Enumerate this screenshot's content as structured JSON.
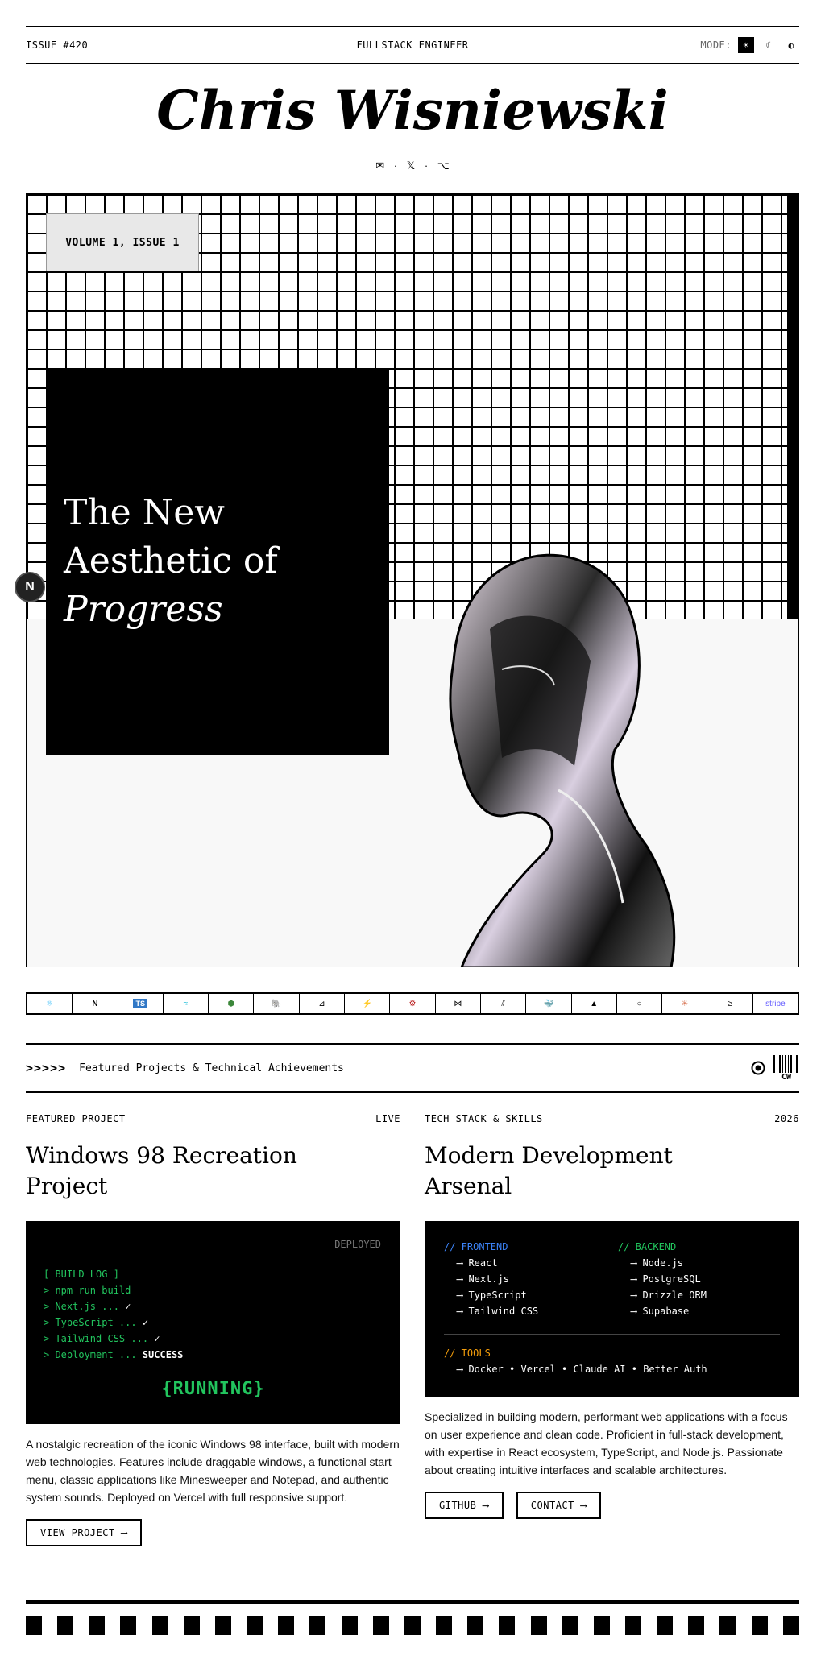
{
  "topbar": {
    "issue": "ISSUE #420",
    "role": "FULLSTACK ENGINEER",
    "mode_label": "MODE:",
    "modes": [
      "☀",
      "☾",
      "◐"
    ]
  },
  "masthead": {
    "name": "Chris Wisniewski"
  },
  "social": {
    "items": [
      "✉",
      "𝕏",
      "⌥"
    ],
    "sep": "·"
  },
  "hero": {
    "volume": "VOLUME 1, ISSUE 1",
    "headline_1": "The New",
    "headline_2": "Aesthetic of",
    "headline_3": "Progress",
    "badge": "N"
  },
  "tech_strip": [
    "⚛",
    "N",
    "TS",
    "≈",
    "⬢",
    "🐘",
    "⊿",
    "⚡",
    "⚙",
    "⋈",
    "⫽",
    "🐳",
    "▲",
    "○",
    "✳",
    "≥",
    "stripe"
  ],
  "featured_bar": {
    "arrows": ">>>>>",
    "label": "Featured Projects & Technical Achievements",
    "logo": "CW"
  },
  "project": {
    "kicker": "FEATURED PROJECT",
    "status": "LIVE",
    "title": "Windows 98 Recreation Project",
    "deployed": "DEPLOYED",
    "log_title": "[ BUILD LOG ]",
    "log_lines": [
      {
        "text": "> npm run build",
        "mark": ""
      },
      {
        "text": "> Next.js ...",
        "mark": "✓"
      },
      {
        "text": "> TypeScript ...",
        "mark": "✓"
      },
      {
        "text": "> Tailwind CSS ...",
        "mark": "✓"
      },
      {
        "text": "> Deployment ...",
        "mark": "SUCCESS"
      }
    ],
    "running": "{RUNNING}",
    "description": "A nostalgic recreation of the iconic Windows 98 interface, built with modern web technologies. Features include draggable windows, a functional start menu, classic applications like Minesweeper and Notepad, and authentic system sounds. Deployed on Vercel with full responsive support.",
    "button": "VIEW PROJECT ⟶"
  },
  "stack": {
    "kicker": "TECH STACK & SKILLS",
    "year": "2026",
    "title": "Modern Development Arsenal",
    "frontend_label": "// FRONTEND",
    "frontend": [
      "⟶  React",
      "⟶  Next.js",
      "⟶  TypeScript",
      "⟶  Tailwind CSS"
    ],
    "backend_label": "// BACKEND",
    "backend": [
      "⟶  Node.js",
      "⟶  PostgreSQL",
      "⟶  Drizzle ORM",
      "⟶  Supabase"
    ],
    "tools_label": "// TOOLS",
    "tools": "⟶  Docker • Vercel • Claude AI • Better Auth",
    "description": "Specialized in building modern, performant web applications with a focus on user experience and clean code. Proficient in full-stack development, with expertise in React ecosystem, TypeScript, and Node.js. Passionate about creating intuitive interfaces and scalable architectures.",
    "btn_github": "GITHUB ⟶",
    "btn_contact": "CONTACT ⟶"
  },
  "colors": {
    "terminal_green": "#22c55e",
    "frontend_blue": "#3b82f6",
    "backend_green": "#22c55e",
    "tools_amber": "#f59e0b"
  }
}
